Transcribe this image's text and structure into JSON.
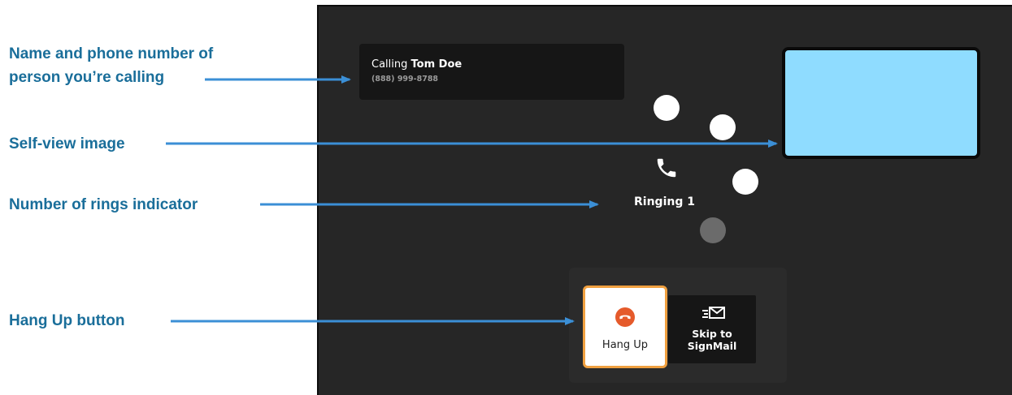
{
  "callouts": {
    "caller_info": "Name and phone number of\nperson you’re calling",
    "self_view": "Self-view image",
    "rings": "Number of rings indicator",
    "hang_up": "Hang Up button"
  },
  "call": {
    "prefix": "Calling",
    "name": "Tom Doe",
    "number": "(888) 999-8788",
    "status": "Ringing 1"
  },
  "ring_indicator": {
    "total": 4,
    "active": 3
  },
  "buttons": {
    "hang_up": "Hang Up",
    "skip_signmail": "Skip to\nSignMail"
  },
  "icons": {
    "phone": "phone-icon",
    "hang_up": "hang-up-icon",
    "signmail": "signmail-envelope-icon"
  },
  "colors": {
    "callout_text": "#1a6e9a",
    "arrow": "#3b8fd6",
    "screen_bg": "#262626",
    "self_view": "#8fdcff",
    "hang_up_icon": "#e55a2b",
    "focus_border": "#f0a040"
  }
}
